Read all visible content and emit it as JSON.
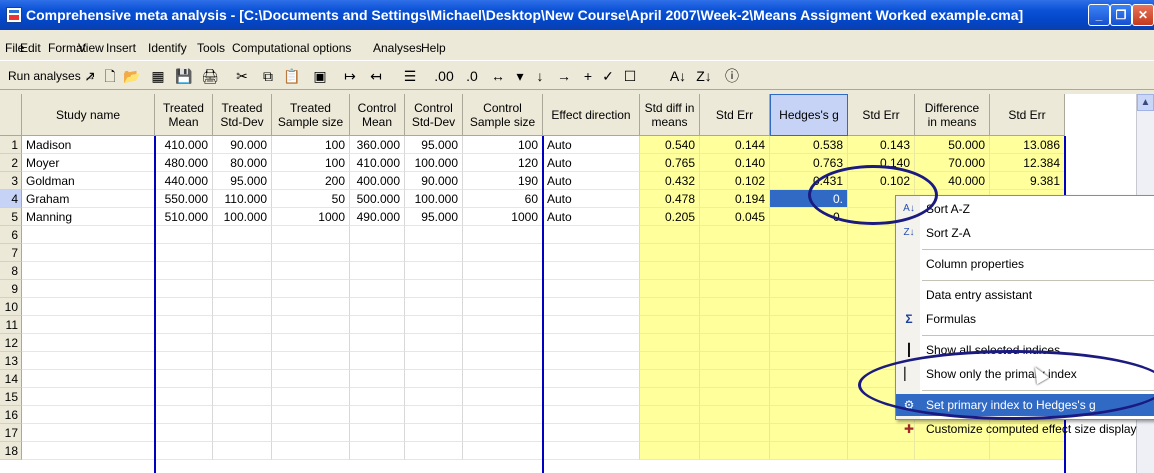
{
  "window": {
    "title": "Comprehensive meta analysis - [C:\\Documents and Settings\\Michael\\Desktop\\New Course\\April 2007\\Week-2\\Means Assigment Worked example.cma]",
    "minimize": "_",
    "maximize": "❐",
    "close": "✕"
  },
  "menubar": [
    "File",
    "Edit",
    "Format",
    "View",
    "Insert",
    "Identify",
    "Tools",
    "Computational options",
    "Analyses",
    "Help"
  ],
  "toolbar": {
    "run_label": "Run analyses →",
    "icons": [
      "↗",
      "🗋",
      "📂",
      "▦",
      "💾",
      "🖨",
      "✂",
      "⧉",
      "📋",
      "▣",
      "↦",
      "↤",
      "☰",
      ".00",
      ".0",
      "↔",
      "▾",
      "↓",
      "→",
      "+",
      "✓",
      "☐",
      "A↓",
      "Z↓",
      "ⓘ"
    ]
  },
  "columns": [
    {
      "label": "Study name",
      "w": 0
    },
    {
      "label": "Treated\nMean"
    },
    {
      "label": "Treated\nStd-Dev"
    },
    {
      "label": "Treated\nSample size"
    },
    {
      "label": "Control\nMean"
    },
    {
      "label": "Control\nStd-Dev"
    },
    {
      "label": "Control\nSample size"
    },
    {
      "label": "Effect direction"
    },
    {
      "label": "Std diff in\nmeans"
    },
    {
      "label": "Std Err"
    },
    {
      "label": "Hedges's g"
    },
    {
      "label": "Std Err"
    },
    {
      "label": "Difference\nin means"
    },
    {
      "label": "Std Err"
    }
  ],
  "rows": [
    {
      "num": "1",
      "cells": [
        "Madison",
        "410.000",
        "90.000",
        "100",
        "360.000",
        "95.000",
        "100",
        "Auto",
        "0.540",
        "0.144",
        "0.538",
        "0.143",
        "50.000",
        "13.086"
      ]
    },
    {
      "num": "2",
      "cells": [
        "Moyer",
        "480.000",
        "80.000",
        "100",
        "410.000",
        "100.000",
        "120",
        "Auto",
        "0.765",
        "0.140",
        "0.763",
        "0.140",
        "70.000",
        "12.384"
      ]
    },
    {
      "num": "3",
      "cells": [
        "Goldman",
        "440.000",
        "95.000",
        "200",
        "400.000",
        "90.000",
        "190",
        "Auto",
        "0.432",
        "0.102",
        "0.431",
        "0.102",
        "40.000",
        "9.381"
      ]
    },
    {
      "num": "4",
      "cells": [
        "Graham",
        "550.000",
        "110.000",
        "50",
        "500.000",
        "100.000",
        "60",
        "Auto",
        "0.478",
        "0.194",
        "0.",
        "",
        "",
        ""
      ]
    },
    {
      "num": "5",
      "cells": [
        "Manning",
        "510.000",
        "100.000",
        "1000",
        "490.000",
        "95.000",
        "1000",
        "Auto",
        "0.205",
        "0.045",
        "0.",
        "",
        "",
        ""
      ]
    },
    {
      "num": "6",
      "cells": []
    },
    {
      "num": "7",
      "cells": []
    },
    {
      "num": "8",
      "cells": []
    },
    {
      "num": "9",
      "cells": []
    },
    {
      "num": "10",
      "cells": []
    },
    {
      "num": "11",
      "cells": []
    },
    {
      "num": "12",
      "cells": []
    },
    {
      "num": "13",
      "cells": []
    },
    {
      "num": "14",
      "cells": []
    },
    {
      "num": "15",
      "cells": []
    },
    {
      "num": "16",
      "cells": []
    },
    {
      "num": "17",
      "cells": []
    },
    {
      "num": "18",
      "cells": []
    }
  ],
  "context_menu": [
    {
      "icon": "A↓",
      "label": "Sort A-Z",
      "icon_name": "sort-az-icon"
    },
    {
      "icon": "Z↓",
      "label": "Sort Z-A",
      "icon_name": "sort-za-icon"
    },
    {
      "sep": true
    },
    {
      "icon": "",
      "label": "Column properties",
      "icon_name": ""
    },
    {
      "sep": true
    },
    {
      "icon": "",
      "label": "Data entry assistant",
      "icon_name": ""
    },
    {
      "icon": "Σ",
      "label": "Formulas",
      "icon_name": "sigma-icon"
    },
    {
      "sep": true
    },
    {
      "icon": "┃",
      "label": "Show all selected indices",
      "icon_name": "columns-icon"
    },
    {
      "icon": "▏",
      "label": "Show only the primary index",
      "icon_name": "column-icon"
    },
    {
      "sep": true
    },
    {
      "icon": "⚙",
      "label": "Set primary index to Hedges's g",
      "icon_name": "primary-index-icon",
      "highlight": true
    },
    {
      "icon": "✚",
      "label": "Customize computed effect size display",
      "icon_name": "plus-icon"
    }
  ],
  "colors": {
    "selected_header": "#c6d3f7",
    "computed_fill": "#ffff9c",
    "highlight": "#316ac5",
    "annotation": "#1a1a80"
  }
}
